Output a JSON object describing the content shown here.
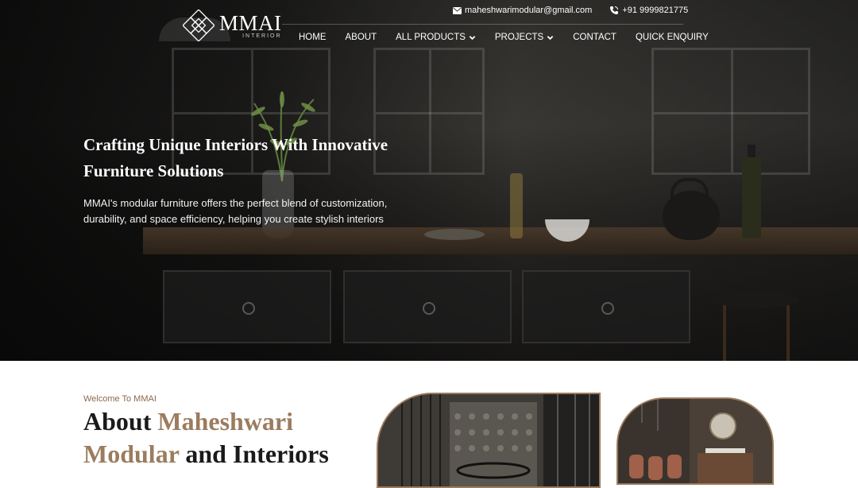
{
  "brand": {
    "name": "MMAI",
    "sub": "INTERIOR"
  },
  "contact": {
    "email": "maheshwarimodular@gmail.com",
    "phone": "+91 9999821775"
  },
  "nav": [
    {
      "label": "HOME",
      "dropdown": false
    },
    {
      "label": "ABOUT",
      "dropdown": false
    },
    {
      "label": "ALL PRODUCTS",
      "dropdown": true
    },
    {
      "label": "PROJECTS",
      "dropdown": true
    },
    {
      "label": "CONTACT",
      "dropdown": false
    },
    {
      "label": "QUICK ENQUIRY",
      "dropdown": false
    }
  ],
  "hero": {
    "title": "Crafting Unique Interiors With Innovative Furniture Solutions",
    "description": "MMAI's modular furniture offers the perfect blend of customization, durability, and space efficiency, helping you create stylish interiors"
  },
  "about": {
    "kicker": "Welcome To MMAI",
    "title_part1": "About ",
    "title_accent1": "Maheshwari",
    "title_accent2": "Modular",
    "title_part2": " and Interiors"
  },
  "colors": {
    "accent": "#9b7c5e",
    "dark": "#1a1a1a"
  }
}
